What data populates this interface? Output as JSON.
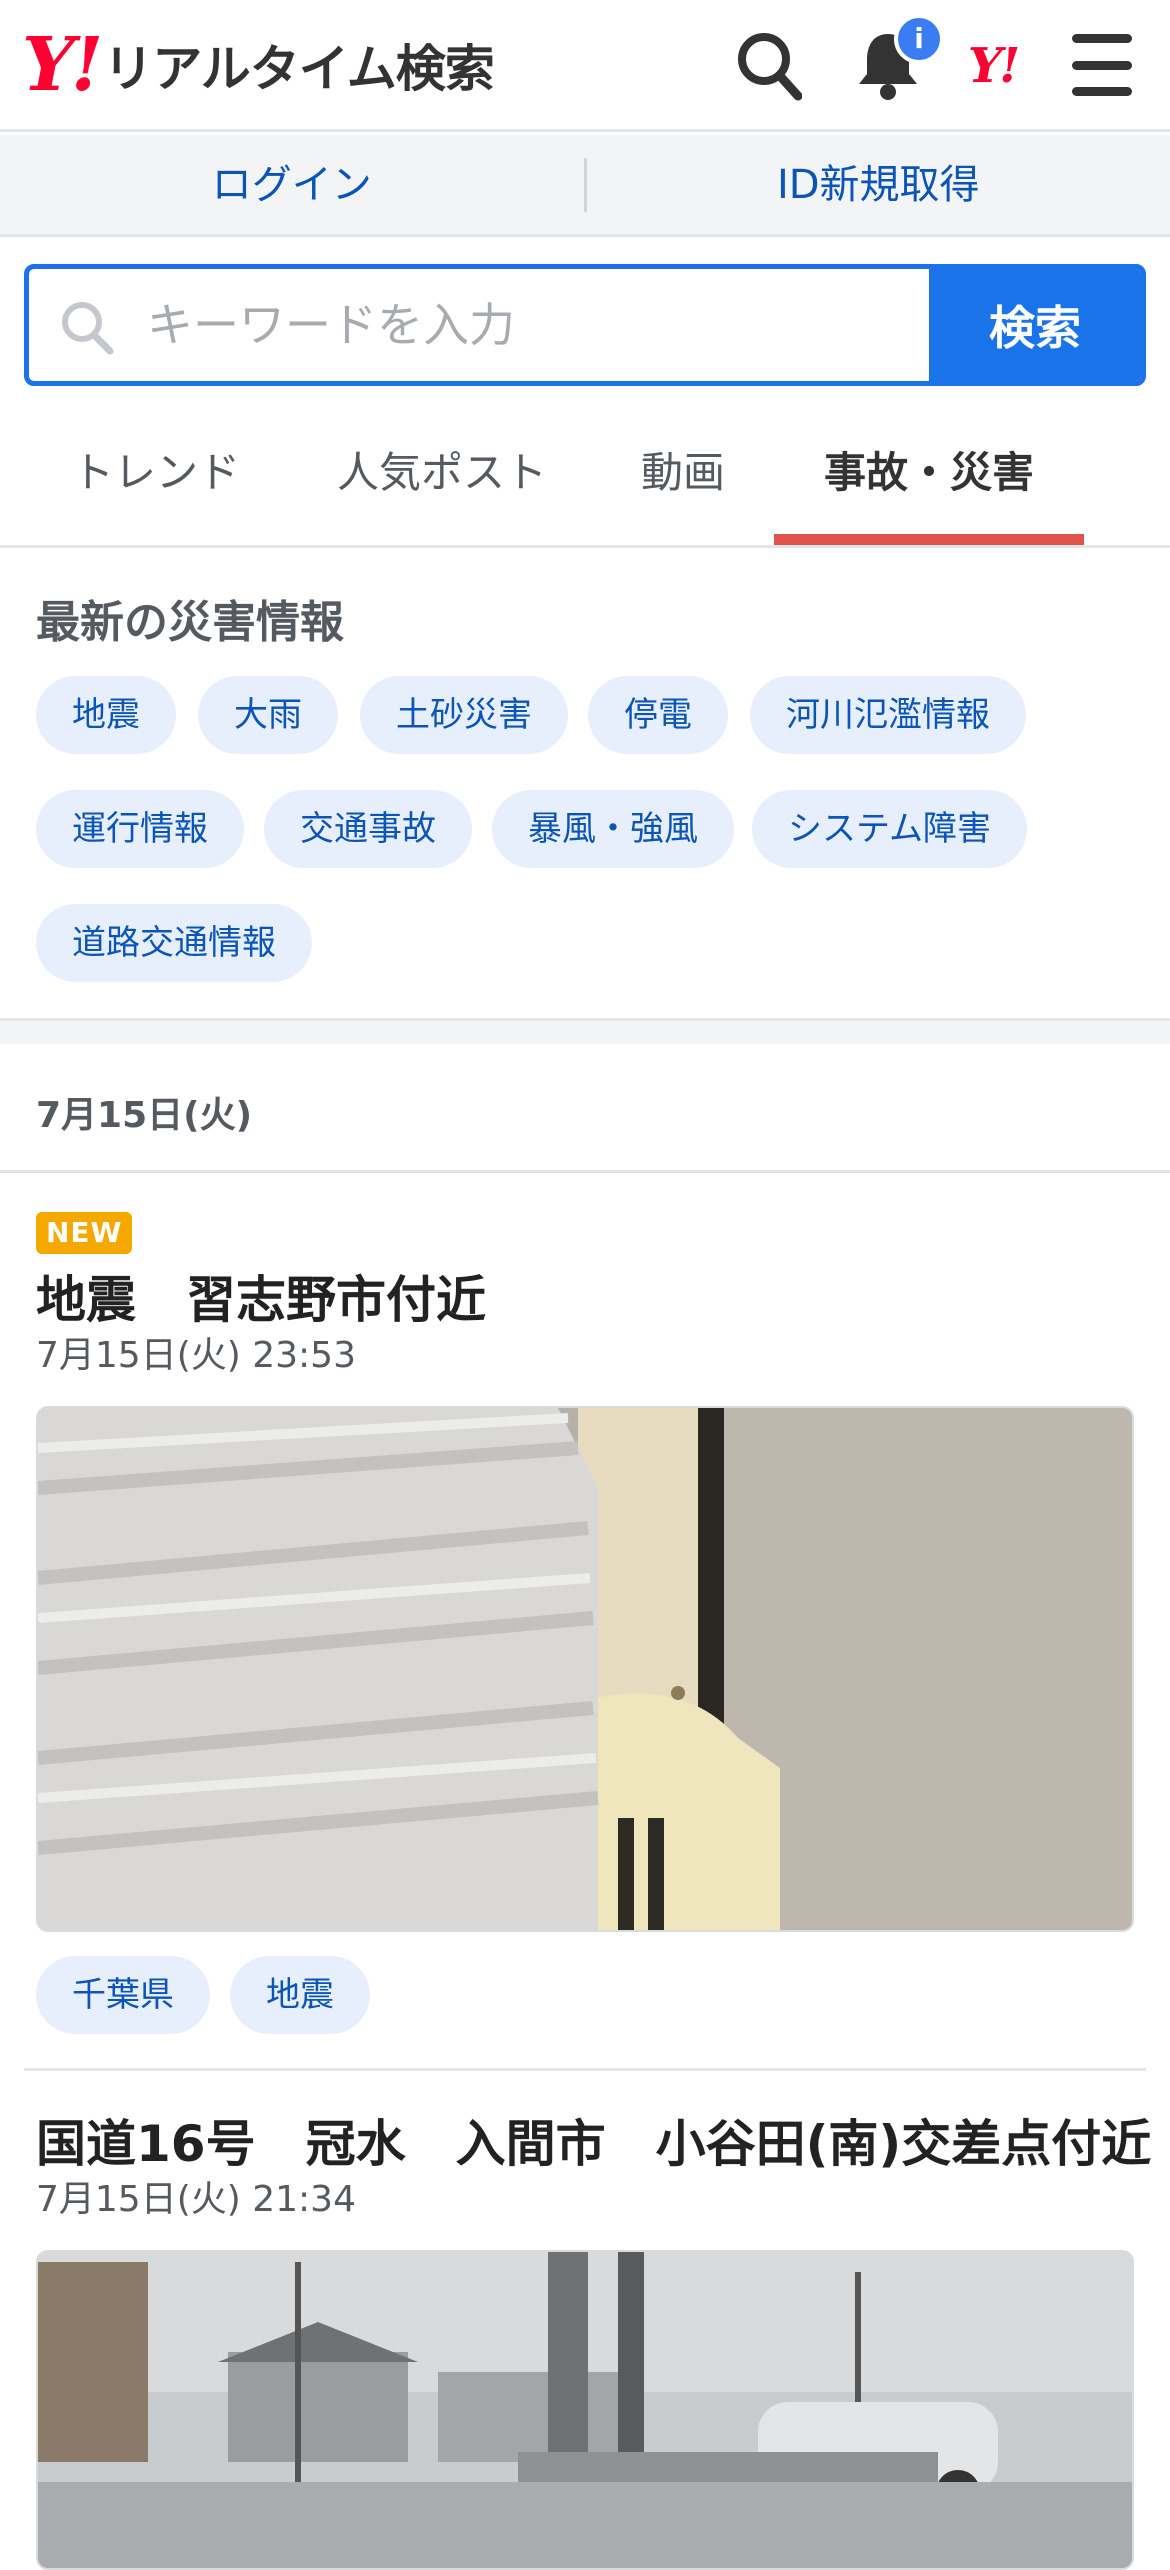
{
  "header": {
    "logo_mark": "Y!",
    "logo_text": "リアルタイム検索",
    "notification_badge": "i",
    "yahoo_mark": "Y!",
    "icons": [
      "search-icon",
      "bell-icon",
      "yahoo-logo-icon",
      "menu-icon"
    ]
  },
  "auth": {
    "login": "ログイン",
    "signup": "ID新規取得"
  },
  "search": {
    "placeholder": "キーワードを入力",
    "button": "検索"
  },
  "tabs": [
    {
      "label": "トレンド",
      "active": false
    },
    {
      "label": "人気ポスト",
      "active": false
    },
    {
      "label": "動画",
      "active": false
    },
    {
      "label": "事故・災害",
      "active": true
    }
  ],
  "disaster": {
    "title": "最新の災害情報",
    "chips": [
      "地震",
      "大雨",
      "土砂災害",
      "停電",
      "河川氾濫情報",
      "運行情報",
      "交通事故",
      "暴風・強風",
      "システム障害",
      "道路交通情報"
    ]
  },
  "date_header": "7月15日(火)",
  "posts": [
    {
      "badge": "NEW",
      "title": "地震　習志野市付近",
      "time": "7月15日(火) 23:53",
      "tags": [
        "千葉県",
        "地震"
      ]
    },
    {
      "title": "国道16号　冠水　入間市　小谷田(南)交差点付近",
      "time": "7月15日(火) 21:34"
    }
  ],
  "colors": {
    "brand_red": "#ff0033",
    "link_blue": "#0b54b8",
    "search_blue": "#1a73e8",
    "tab_accent": "#e0544b",
    "chip_bg": "#e8effc",
    "new_badge": "#f5a800"
  }
}
